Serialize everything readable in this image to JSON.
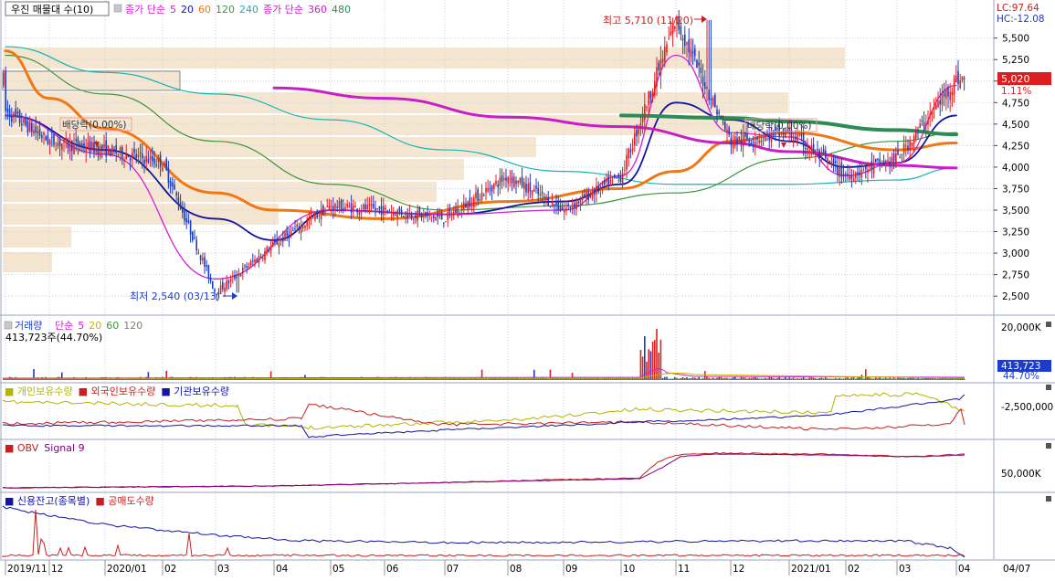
{
  "colors": {
    "bg": "#ffffff",
    "grid": "#c8d2e6",
    "divider": "#9aa6be",
    "up": "#e02020",
    "down": "#1a3cbe",
    "ma5": "#d21ed2",
    "ma20": "#1414a0",
    "ma60": "#f07814",
    "ma120": "#3c963c",
    "ma240": "#14b4b4",
    "ma360": "#c81ec8",
    "ma480": "#2d8c55",
    "volprofile": "#f5e6d2",
    "flagbox": "#f0a0a0"
  },
  "price_panel": {
    "title": "우진 매물대 수(10)",
    "legend": [
      {
        "text": "종가 단순",
        "color": "#d21ed2"
      },
      {
        "text": "5",
        "color": "#d21ed2"
      },
      {
        "text": "20",
        "color": "#1414a0"
      },
      {
        "text": "60",
        "color": "#f07814"
      },
      {
        "text": "120",
        "color": "#3c963c"
      },
      {
        "text": "240",
        "color": "#14b4b4"
      },
      {
        "text": "종가 단순",
        "color": "#c81ec8"
      },
      {
        "text": "360",
        "color": "#c81ec8"
      },
      {
        "text": "480",
        "color": "#2d8c55"
      }
    ],
    "lc": "LC:97.64",
    "hc": "HC:-12.08",
    "high_label": "최고 5,710 (11/20)",
    "low_label": "최저 2,540 (03/13)",
    "dividend_label_1": "배당락(0.00%)",
    "dividend_label_2": "배당락(0.00%)",
    "current_price": "5,020",
    "current_change": "1.11%"
  },
  "volume_panel": {
    "title": "거래량",
    "legend": [
      {
        "text": "단순",
        "color": "#d21ed2"
      },
      {
        "text": "5",
        "color": "#d21ed2"
      },
      {
        "text": "20",
        "color": "#c8b400"
      },
      {
        "text": "60",
        "color": "#3c963c"
      },
      {
        "text": "120",
        "color": "#808080"
      }
    ],
    "sub": "413,723주(44.70%)",
    "axis": "20,000K",
    "current": "413,723",
    "current_pct": "44.70%"
  },
  "holder_panel": {
    "legend": [
      {
        "text": "개인보유수량",
        "color": "#b4b400"
      },
      {
        "text": "외국인보유수량",
        "color": "#c81e1e"
      },
      {
        "text": "기관보유수량",
        "color": "#1414a0"
      }
    ],
    "axis": "-2,500,000"
  },
  "obv_panel": {
    "legend": [
      {
        "text": "OBV",
        "color": "#c81e1e"
      },
      {
        "text": "Signal 9",
        "color": "#800080"
      }
    ],
    "axis": "50,000K"
  },
  "credit_panel": {
    "legend": [
      {
        "text": "신용잔고(종목별)",
        "color": "#1414a0"
      },
      {
        "text": "공매도수량",
        "color": "#c81e1e"
      }
    ]
  },
  "x_labels": [
    "2019/11",
    "12",
    "2020/01",
    "02",
    "03",
    "04",
    "05",
    "06",
    "07",
    "08",
    "09",
    "10",
    "11",
    "12",
    "2021/01",
    "02",
    "03",
    "04"
  ],
  "x_end_label": "04/07",
  "chart_data": {
    "type": "candlestick",
    "title": "우진 매물대 수(10)",
    "y_ticks": [
      2500,
      2750,
      3000,
      3250,
      3500,
      3750,
      4000,
      4250,
      4500,
      4750,
      5000,
      5250,
      5500
    ],
    "y_tick_labels": [
      "2,500",
      "2,750",
      "3,000",
      "3,250",
      "3,500",
      "3,750",
      "4,000",
      "4,250",
      "4,500",
      "4,750",
      "5,000",
      "5,250",
      "5,500"
    ],
    "ylim": [
      2300,
      5900
    ],
    "x_labels": [
      "2019/11",
      "12",
      "2020/01",
      "02",
      "03",
      "04",
      "05",
      "06",
      "07",
      "08",
      "09",
      "10",
      "11",
      "12",
      "2021/01",
      "02",
      "03",
      "04"
    ],
    "close_path": [
      [
        "2019/11",
        4650
      ],
      [
        "12",
        4300
      ],
      [
        "2020/01",
        4200
      ],
      [
        "02",
        4050
      ],
      [
        "03",
        2540
      ],
      [
        "04",
        3100
      ],
      [
        "05",
        3550
      ],
      [
        "06",
        3500
      ],
      [
        "07",
        3400
      ],
      [
        "08",
        3900
      ],
      [
        "09",
        3500
      ],
      [
        "10",
        3900
      ],
      [
        "11",
        5710
      ],
      [
        "12",
        4300
      ],
      [
        "2021/01",
        4400
      ],
      [
        "02",
        3900
      ],
      [
        "03",
        4100
      ],
      [
        "04",
        5020
      ]
    ],
    "high": {
      "value": 5710,
      "date": "11/20"
    },
    "low": {
      "value": 2540,
      "date": "03/13"
    },
    "last_close": 5020,
    "change_pct": 1.11,
    "moving_averages": {
      "ma5": {
        "name": "5",
        "color": "#d21ed2",
        "points": [
          [
            "2019/11",
            4600
          ],
          [
            "2020/01",
            4150
          ],
          [
            "03",
            2700
          ],
          [
            "05",
            3500
          ],
          [
            "07",
            3450
          ],
          [
            "09",
            3500
          ],
          [
            "10",
            3900
          ],
          [
            "11",
            5300
          ],
          [
            "12",
            4400
          ],
          [
            "2021/01",
            4350
          ],
          [
            "02",
            3900
          ],
          [
            "03",
            4050
          ],
          [
            "04",
            4950
          ]
        ]
      },
      "ma20": {
        "name": "20",
        "color": "#1414a0",
        "points": [
          [
            "2019/11",
            4600
          ],
          [
            "2020/01",
            4200
          ],
          [
            "03",
            3400
          ],
          [
            "04",
            3150
          ],
          [
            "05",
            3500
          ],
          [
            "07",
            3450
          ],
          [
            "09",
            3600
          ],
          [
            "10",
            3800
          ],
          [
            "11",
            4750
          ],
          [
            "12",
            4550
          ],
          [
            "2021/01",
            4300
          ],
          [
            "02",
            4000
          ],
          [
            "03",
            4050
          ],
          [
            "04",
            4600
          ]
        ]
      },
      "ma60": {
        "name": "60",
        "color": "#f07814",
        "points": [
          [
            "2019/11",
            5350
          ],
          [
            "12",
            4800
          ],
          [
            "2020/01",
            4450
          ],
          [
            "03",
            3700
          ],
          [
            "04",
            3500
          ],
          [
            "06",
            3400
          ],
          [
            "08",
            3600
          ],
          [
            "10",
            3750
          ],
          [
            "11",
            3950
          ],
          [
            "12",
            4300
          ],
          [
            "2021/01",
            4400
          ],
          [
            "03",
            4200
          ],
          [
            "04",
            4280
          ]
        ]
      },
      "ma120": {
        "name": "120",
        "color": "#3c963c",
        "points": [
          [
            "2019/11",
            5300
          ],
          [
            "2020/01",
            4850
          ],
          [
            "03",
            4300
          ],
          [
            "05",
            3800
          ],
          [
            "07",
            3500
          ],
          [
            "09",
            3550
          ],
          [
            "11",
            3700
          ],
          [
            "2021/01",
            4100
          ],
          [
            "03",
            4300
          ],
          [
            "04",
            4400
          ]
        ]
      },
      "ma240": {
        "name": "240",
        "color": "#14b4b4",
        "points": [
          [
            "2019/11",
            5400
          ],
          [
            "2020/01",
            5100
          ],
          [
            "03",
            4850
          ],
          [
            "05",
            4550
          ],
          [
            "07",
            4200
          ],
          [
            "09",
            3950
          ],
          [
            "11",
            3800
          ],
          [
            "2021/01",
            3800
          ],
          [
            "03",
            3850
          ],
          [
            "04",
            3990
          ]
        ]
      },
      "ma360": {
        "name": "360",
        "color": "#c81ec8",
        "points": [
          [
            "04",
            4920
          ],
          [
            "06",
            4800
          ],
          [
            "08",
            4580
          ],
          [
            "10",
            4470
          ],
          [
            "12",
            4280
          ],
          [
            "2021/01",
            4180
          ],
          [
            "03",
            4020
          ],
          [
            "04",
            3990
          ]
        ]
      },
      "ma480": {
        "name": "480",
        "color": "#2d8c55",
        "points": [
          [
            "10",
            4600
          ],
          [
            "12",
            4570
          ],
          [
            "2021/01",
            4530
          ],
          [
            "03",
            4430
          ],
          [
            "04",
            4380
          ]
        ]
      }
    }
  }
}
